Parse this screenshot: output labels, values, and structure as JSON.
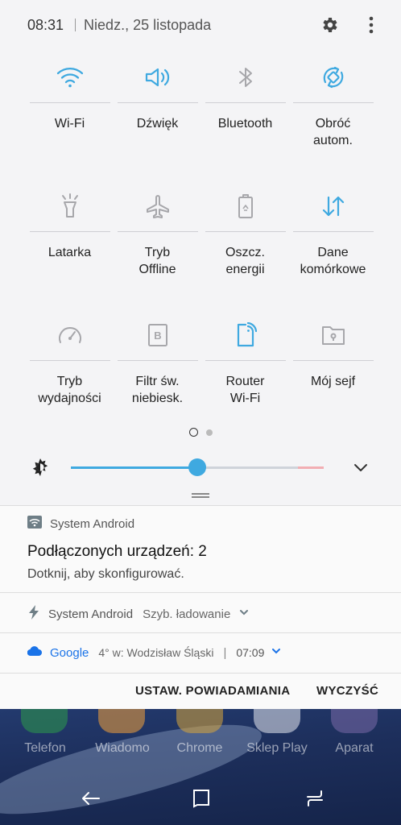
{
  "status": {
    "time": "08:31",
    "date": "Niedz., 25 listopada"
  },
  "icons": {
    "settings": "gear-icon",
    "menu": "more-vertical-icon"
  },
  "quick_settings": [
    {
      "label": "Wi-Fi",
      "icon": "wifi-icon",
      "active": true
    },
    {
      "label": "Dźwięk",
      "icon": "speaker-icon",
      "active": true
    },
    {
      "label": "Bluetooth",
      "icon": "bluetooth-icon",
      "active": false
    },
    {
      "label": "Obróć\nautom.",
      "icon": "auto-rotate-icon",
      "active": true
    },
    {
      "label": "Latarka",
      "icon": "flashlight-icon",
      "active": false
    },
    {
      "label": "Tryb\nOffline",
      "icon": "airplane-icon",
      "active": false
    },
    {
      "label": "Oszcz.\nenergii",
      "icon": "battery-saver-icon",
      "active": false
    },
    {
      "label": "Dane\nkomórkowe",
      "icon": "mobile-data-icon",
      "active": true
    },
    {
      "label": "Tryb\nwydajności",
      "icon": "performance-icon",
      "active": false
    },
    {
      "label": "Filtr św.\nniebiesk.",
      "icon": "blue-light-filter-icon",
      "active": false
    },
    {
      "label": "Router\nWi-Fi",
      "icon": "hotspot-icon",
      "active": true
    },
    {
      "label": "Mój sejf",
      "icon": "secure-folder-icon",
      "active": false
    }
  ],
  "pager": {
    "pages": 2,
    "current": 1
  },
  "brightness": {
    "level": 0.5
  },
  "notifications": [
    {
      "app": "System Android",
      "title": "Podłączonych urządzeń: 2",
      "text": "Dotknij, aby skonfigurować.",
      "icon": "wifi-hotspot-icon"
    },
    {
      "app": "System Android",
      "text": "Szyb. ładowanie",
      "icon": "charging-bolt-icon"
    },
    {
      "app": "Google",
      "text": "4° w: Wodzisław Śląski",
      "time": "07:09",
      "icon": "cloud-icon"
    }
  ],
  "actions": {
    "settings": "USTAW. POWIADAMIANIA",
    "clear": "WYCZYŚĆ"
  },
  "home_apps": [
    "Telefon",
    "Wiadomo",
    "Chrome",
    "Sklep Play",
    "Aparat"
  ],
  "colors": {
    "accent": "#3fa9e0",
    "inactive_icon": "#a7a7ab",
    "google_blue": "#1a73e8"
  }
}
